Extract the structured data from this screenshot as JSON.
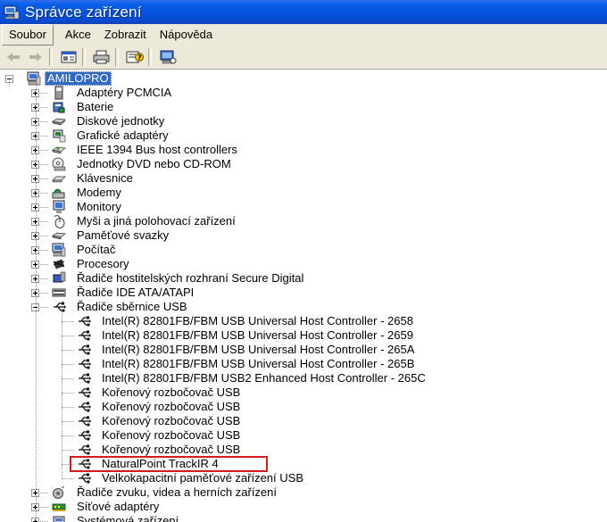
{
  "window": {
    "title": "Správce zařízení"
  },
  "menu": [
    {
      "label": "Soubor",
      "active": true
    },
    {
      "label": "Akce",
      "active": false
    },
    {
      "label": "Zobrazit",
      "active": false
    },
    {
      "label": "Nápověda",
      "active": false
    }
  ],
  "toolbar": [
    {
      "icon": "back-arrow-icon",
      "enabled": false
    },
    {
      "icon": "forward-arrow-icon",
      "enabled": false
    },
    {
      "icon": "properties-icon",
      "enabled": true
    },
    {
      "icon": "print-icon",
      "enabled": true
    },
    {
      "icon": "help-icon",
      "enabled": true
    },
    {
      "icon": "scan-hardware-icon",
      "enabled": true
    }
  ],
  "tree": {
    "root": {
      "label": "AMILOPRO",
      "icon": "computer-icon",
      "selected": true
    },
    "categories": [
      {
        "label": "Adaptéry PCMCIA",
        "icon": "pcmcia-icon"
      },
      {
        "label": "Baterie",
        "icon": "battery-icon"
      },
      {
        "label": "Diskové jednotky",
        "icon": "disk-drive-icon"
      },
      {
        "label": "Grafické adaptéry",
        "icon": "display-adapter-icon"
      },
      {
        "label": "IEEE 1394 Bus host controllers",
        "icon": "ieee1394-icon"
      },
      {
        "label": "Jednotky DVD nebo CD-ROM",
        "icon": "cdrom-icon"
      },
      {
        "label": "Klávesnice",
        "icon": "keyboard-icon"
      },
      {
        "label": "Modemy",
        "icon": "modem-icon"
      },
      {
        "label": "Monitory",
        "icon": "monitor-icon"
      },
      {
        "label": "Myši a jiná polohovací zařízení",
        "icon": "mouse-icon"
      },
      {
        "label": "Paměťové svazky",
        "icon": "storage-volume-icon"
      },
      {
        "label": "Počítač",
        "icon": "computer-icon"
      },
      {
        "label": "Procesory",
        "icon": "processor-icon"
      },
      {
        "label": "Řadiče hostitelských rozhraní Secure Digital",
        "icon": "sd-host-icon"
      },
      {
        "label": "Řadiče IDE ATA/ATAPI",
        "icon": "ide-controller-icon"
      },
      {
        "label": "Řadiče sběrnice USB",
        "icon": "usb-icon",
        "expanded": true,
        "children": [
          {
            "label": "Intel(R) 82801FB/FBM USB Universal Host Controller - 2658",
            "icon": "usb-icon"
          },
          {
            "label": "Intel(R) 82801FB/FBM USB Universal Host Controller - 2659",
            "icon": "usb-icon"
          },
          {
            "label": "Intel(R) 82801FB/FBM USB Universal Host Controller - 265A",
            "icon": "usb-icon"
          },
          {
            "label": "Intel(R) 82801FB/FBM USB Universal Host Controller - 265B",
            "icon": "usb-icon"
          },
          {
            "label": "Intel(R) 82801FB/FBM USB2 Enhanced Host Controller - 265C",
            "icon": "usb-icon"
          },
          {
            "label": "Kořenový rozbočovač USB",
            "icon": "usb-icon"
          },
          {
            "label": "Kořenový rozbočovač USB",
            "icon": "usb-icon"
          },
          {
            "label": "Kořenový rozbočovač USB",
            "icon": "usb-icon"
          },
          {
            "label": "Kořenový rozbočovač USB",
            "icon": "usb-icon"
          },
          {
            "label": "Kořenový rozbočovač USB",
            "icon": "usb-icon"
          },
          {
            "label": "NaturalPoint TrackIR 4",
            "icon": "usb-icon",
            "highlighted": true
          },
          {
            "label": "Velkokapacitní paměťové zařízení USB",
            "icon": "usb-icon"
          }
        ]
      },
      {
        "label": "Řadiče zvuku, videa a herních zařízení",
        "icon": "sound-icon"
      },
      {
        "label": "Síťové adaptéry",
        "icon": "network-adapter-icon"
      },
      {
        "label": "Systémová zařízení",
        "icon": "system-device-icon"
      }
    ]
  },
  "colors": {
    "titlebar": "#0a5fe8",
    "chrome": "#ece9d8",
    "selection": "#316ac5",
    "highlight_border": "#d61a1a"
  }
}
